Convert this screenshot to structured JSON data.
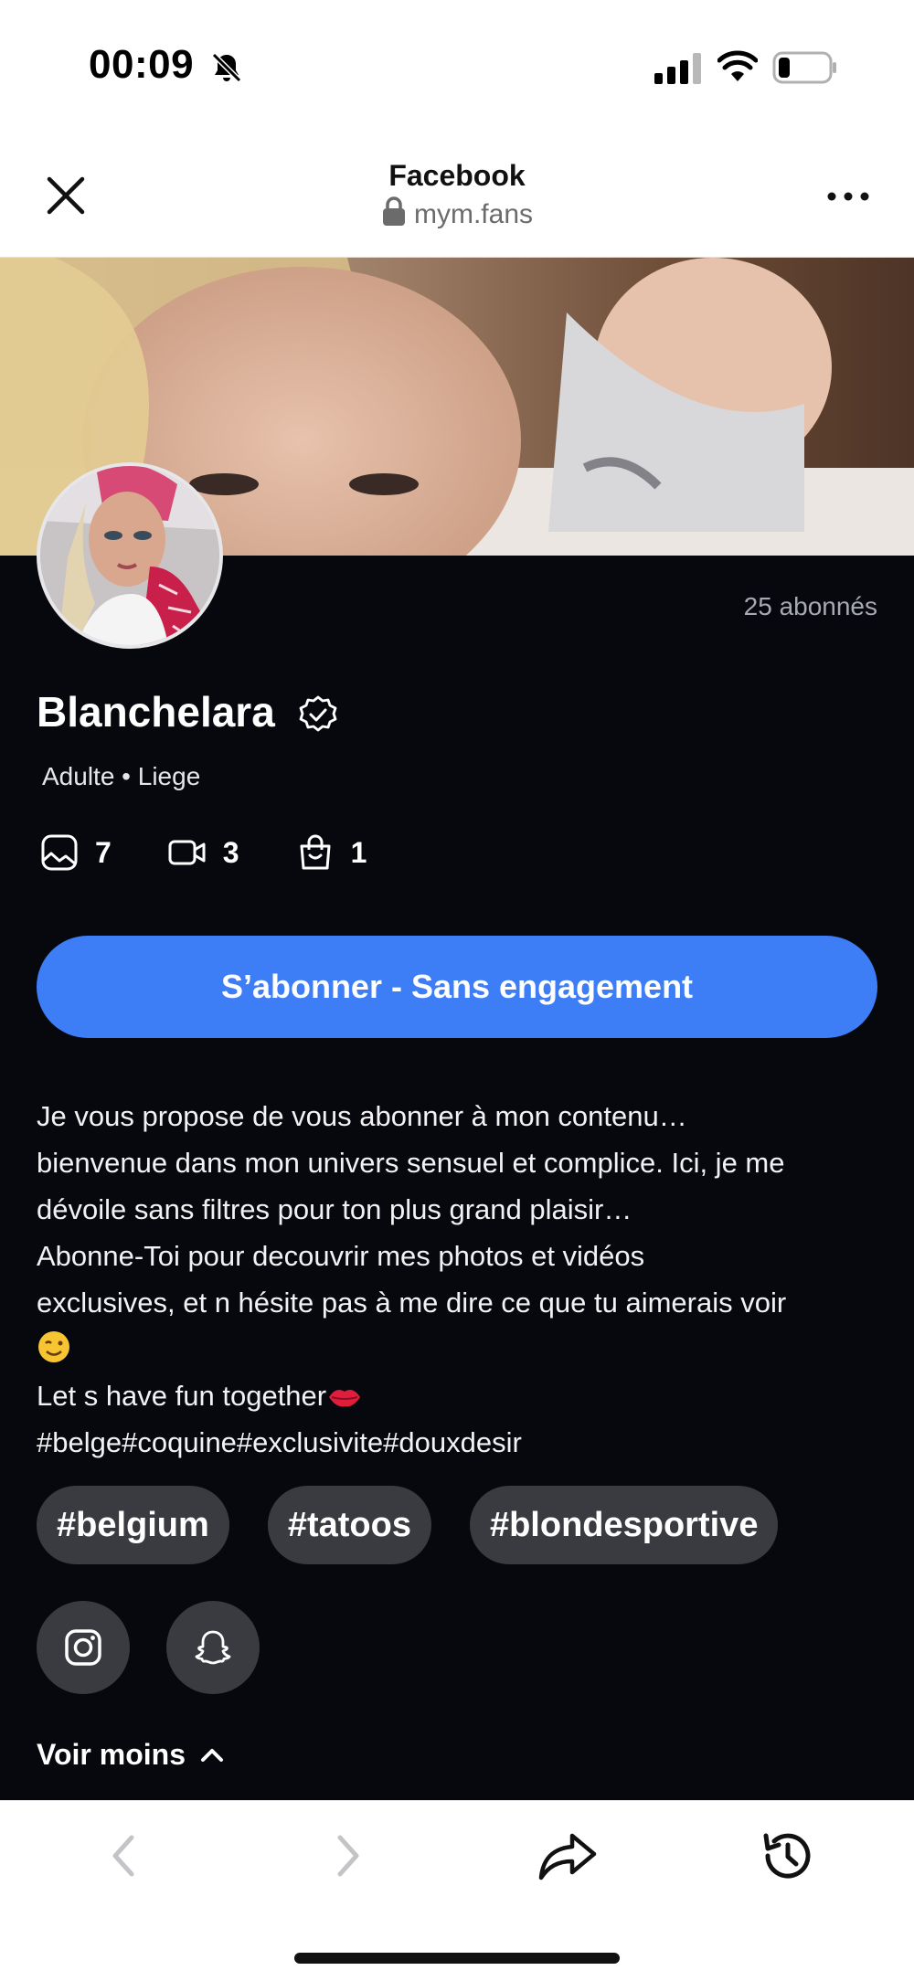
{
  "status_bar": {
    "time": "00:09"
  },
  "browser": {
    "title": "Facebook",
    "url": "mym.fans"
  },
  "profile": {
    "subscribers": "25 abonnés",
    "name": "Blanchelara",
    "meta": "Adulte • Liege",
    "stats": {
      "photos": "7",
      "videos": "3",
      "products": "1"
    },
    "subscribe_label": "S’abonner - Sans engagement",
    "bio": {
      "line1": "Je vous propose de vous abonner à mon contenu…",
      "line2": "bienvenue dans mon univers sensuel et complice. Ici, je me",
      "line3": "dévoile sans filtres pour ton plus grand plaisir…",
      "line4": "Abonne-Toi pour decouvrir mes photos et vidéos",
      "line5": "exclusives, et n hésite pas à me dire ce que tu aimerais voir",
      "line6": "Let s have fun together",
      "line7": "#belge#coquine#exclusivite#douxdesir"
    },
    "tags": [
      "#belgium",
      "#tatoos",
      "#blondesportive"
    ],
    "toggle_label": "Voir moins"
  },
  "colors": {
    "accent": "#3d7ef6",
    "profile_bg": "#07080d",
    "chip_bg": "#3a3b40"
  }
}
